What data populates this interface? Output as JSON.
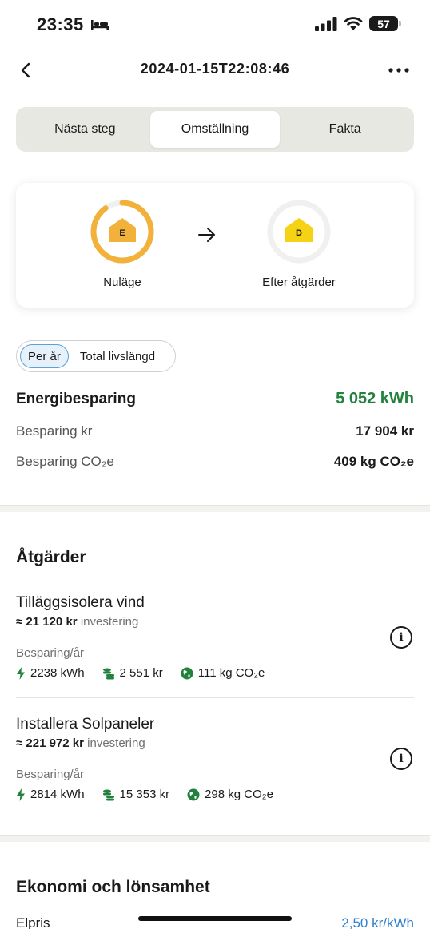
{
  "status": {
    "time": "23:35",
    "battery": "57"
  },
  "header": {
    "title": "2024-01-15T22:08:46"
  },
  "tabs": [
    {
      "label": "Nästa steg",
      "active": false
    },
    {
      "label": "Omställning",
      "active": true
    },
    {
      "label": "Fakta",
      "active": false
    }
  ],
  "energy_class": {
    "current": {
      "letter": "E",
      "label": "Nuläge",
      "color": "#f2b13a",
      "progress": 0.9
    },
    "after": {
      "letter": "D",
      "label": "Efter åtgärder",
      "color": "#f5d214",
      "progress": 0.0
    }
  },
  "period_toggle": {
    "options": [
      "Per år",
      "Total livslängd"
    ],
    "selected": "Per år"
  },
  "savings": {
    "energy": {
      "label": "Energibesparing",
      "value": "5 052 kWh"
    },
    "money": {
      "label": "Besparing kr",
      "value": "17 904 kr"
    },
    "co2": {
      "label": "Besparing CO₂e",
      "value": "409 kg CO₂e"
    }
  },
  "measures_section": {
    "title": "Åtgärder",
    "items": [
      {
        "title": "Tilläggsisolera vind",
        "investment_amount": "≈ 21 120 kr",
        "investment_label": "investering",
        "subtitle": "Besparing/år",
        "kwh": "2238 kWh",
        "kr": "2 551 kr",
        "co2": "111 kg CO₂e"
      },
      {
        "title": "Installera Solpaneler",
        "investment_amount": "≈ 221 972 kr",
        "investment_label": "investering",
        "subtitle": "Besparing/år",
        "kwh": "2814 kWh",
        "kr": "15 353 kr",
        "co2": "298 kg CO₂e"
      }
    ]
  },
  "economy_section": {
    "title": "Ekonomi och lönsamhet",
    "elpris_label": "Elpris",
    "elpris_value": "2,50 kr/kWh"
  },
  "colors": {
    "green": "#21813d",
    "link": "#2f7fd0",
    "ring_track": "#f0f0ee"
  }
}
